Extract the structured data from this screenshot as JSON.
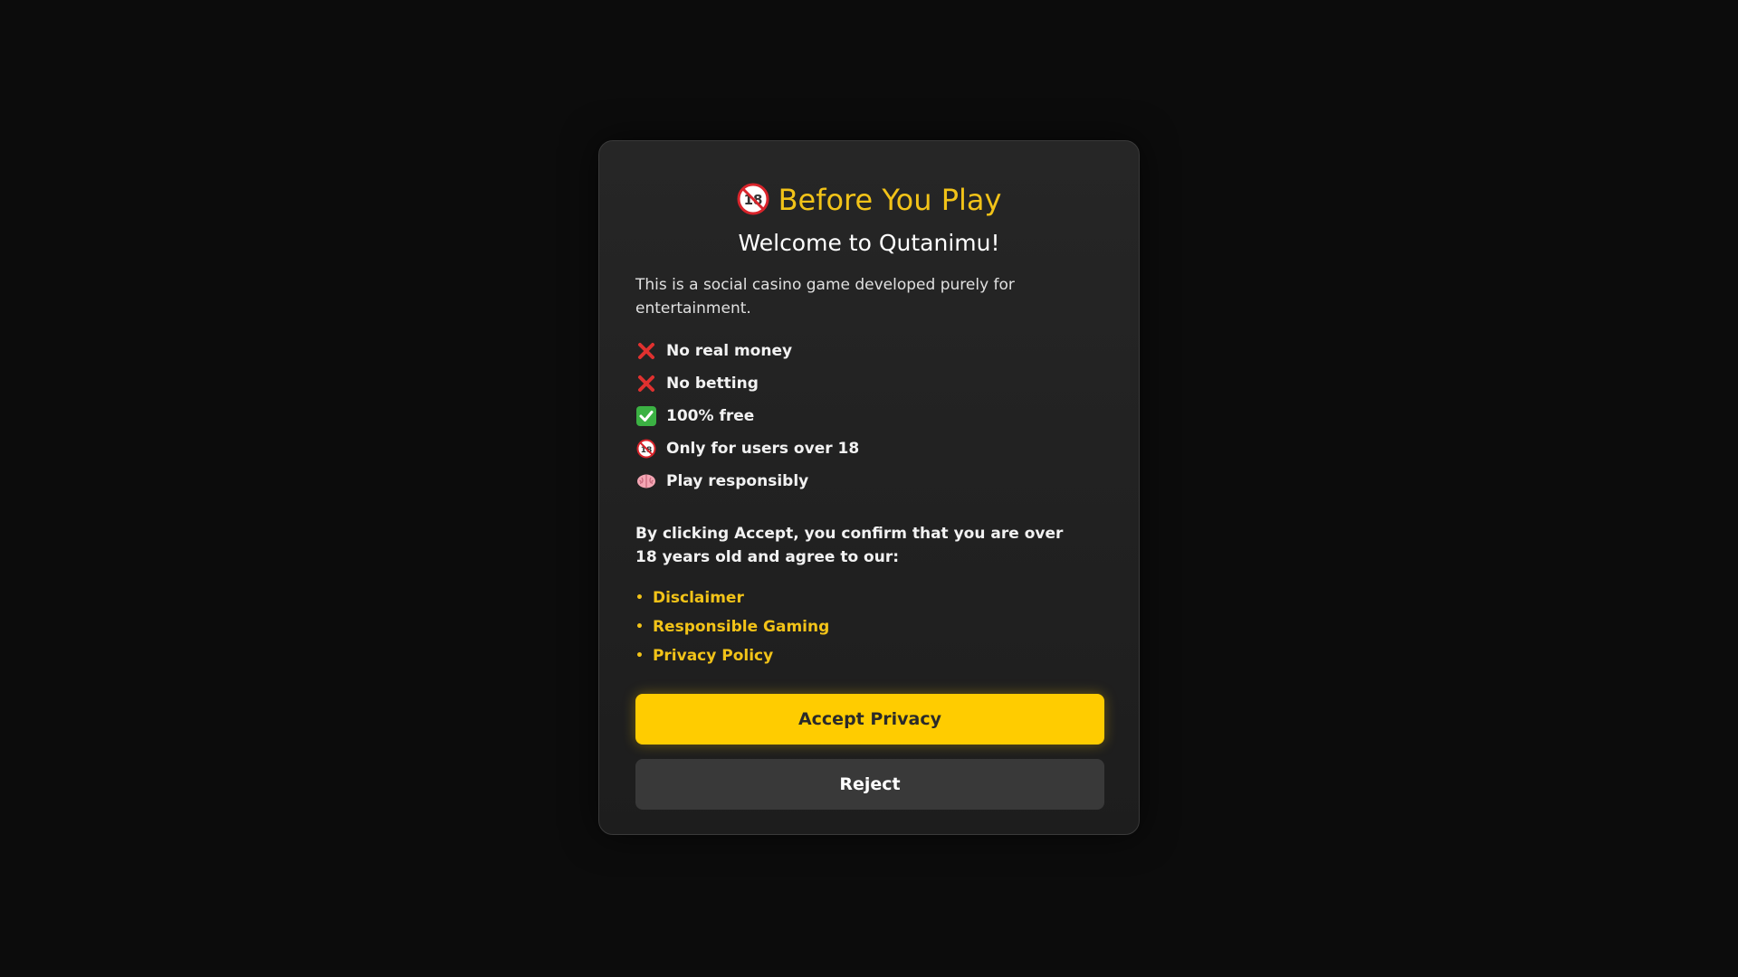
{
  "modal": {
    "title": "Before You Play",
    "title_icon": "adults-only-18-icon",
    "subtitle": "Welcome to Qutanimu!",
    "intro": "This is a social casino game developed purely for entertainment.",
    "features": [
      {
        "icon": "cross-mark-icon",
        "label": "No real money"
      },
      {
        "icon": "cross-mark-icon",
        "label": "No betting"
      },
      {
        "icon": "check-mark-icon",
        "label": "100% free"
      },
      {
        "icon": "adults-only-18-icon",
        "label": "Only for users over 18"
      },
      {
        "icon": "brain-icon",
        "label": "Play responsibly"
      }
    ],
    "confirm_text": "By clicking Accept, you confirm that you are over 18 years old and agree to our:",
    "links": [
      {
        "label": "Disclaimer"
      },
      {
        "label": "Responsible Gaming"
      },
      {
        "label": "Privacy Policy"
      }
    ],
    "accept_label": "Accept Privacy",
    "reject_label": "Reject"
  },
  "colors": {
    "accent": "#ffcc00",
    "title": "#f2c318",
    "background": "#0c0c0c",
    "card": "#232323",
    "reject_button": "#393939",
    "cross": "#e0312f",
    "check": "#3bb143"
  }
}
